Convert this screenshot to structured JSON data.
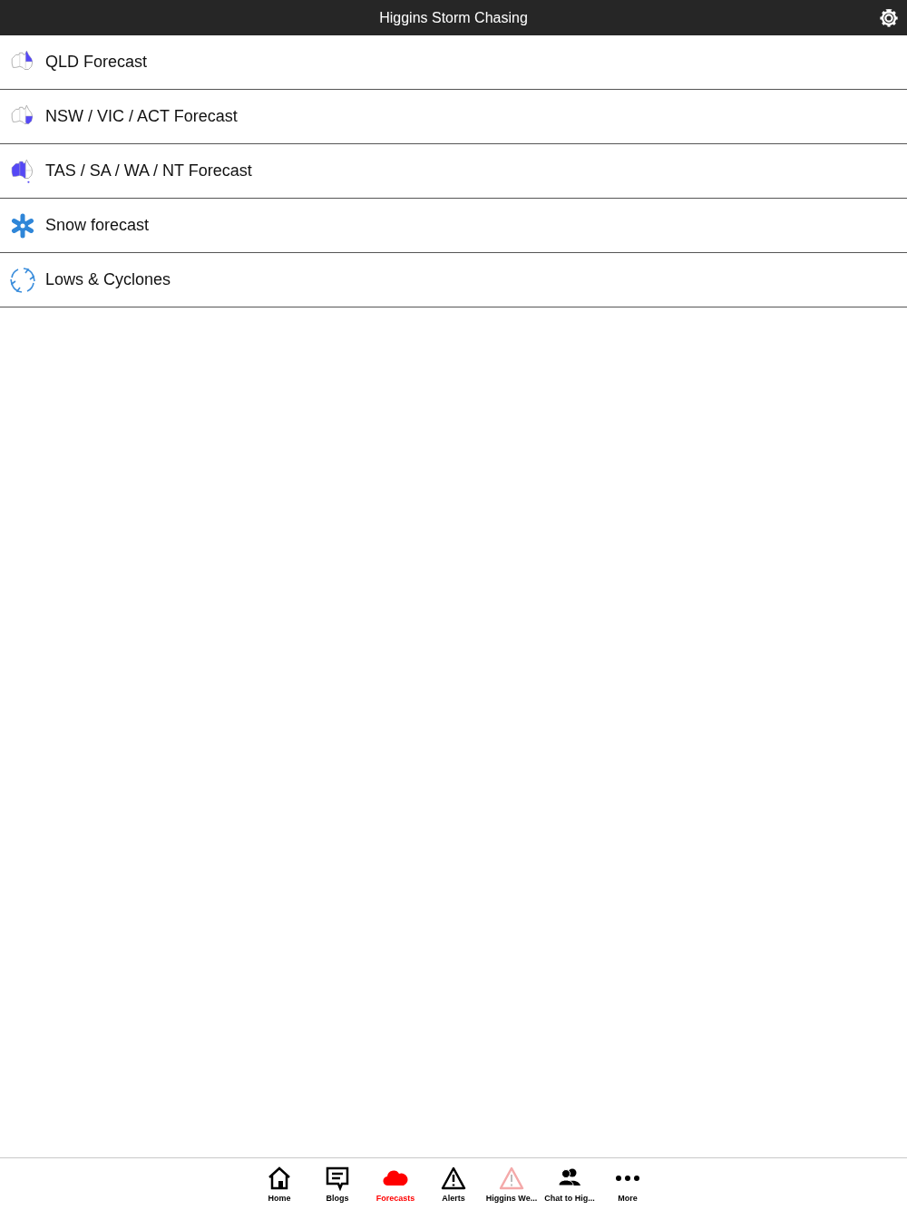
{
  "header": {
    "title": "Higgins Storm Chasing"
  },
  "items": [
    {
      "label": "QLD Forecast",
      "kind": "map-east"
    },
    {
      "label": "NSW / VIC / ACT Forecast",
      "kind": "map-southeast"
    },
    {
      "label": "TAS / SA / WA / NT Forecast",
      "kind": "map-west"
    },
    {
      "label": "Snow forecast",
      "kind": "snow"
    },
    {
      "label": "Lows & Cyclones",
      "kind": "cycle"
    }
  ],
  "tabs": [
    {
      "label": "Home",
      "kind": "home",
      "selected": false
    },
    {
      "label": "Blogs",
      "kind": "blog",
      "selected": false
    },
    {
      "label": "Forecasts",
      "kind": "cloud",
      "selected": true
    },
    {
      "label": "Alerts",
      "kind": "alert",
      "selected": false
    },
    {
      "label": "Higgins We...",
      "kind": "alert-faint",
      "selected": false
    },
    {
      "label": "Chat to Hig...",
      "kind": "people",
      "selected": false
    },
    {
      "label": "More",
      "kind": "more",
      "selected": false
    }
  ]
}
